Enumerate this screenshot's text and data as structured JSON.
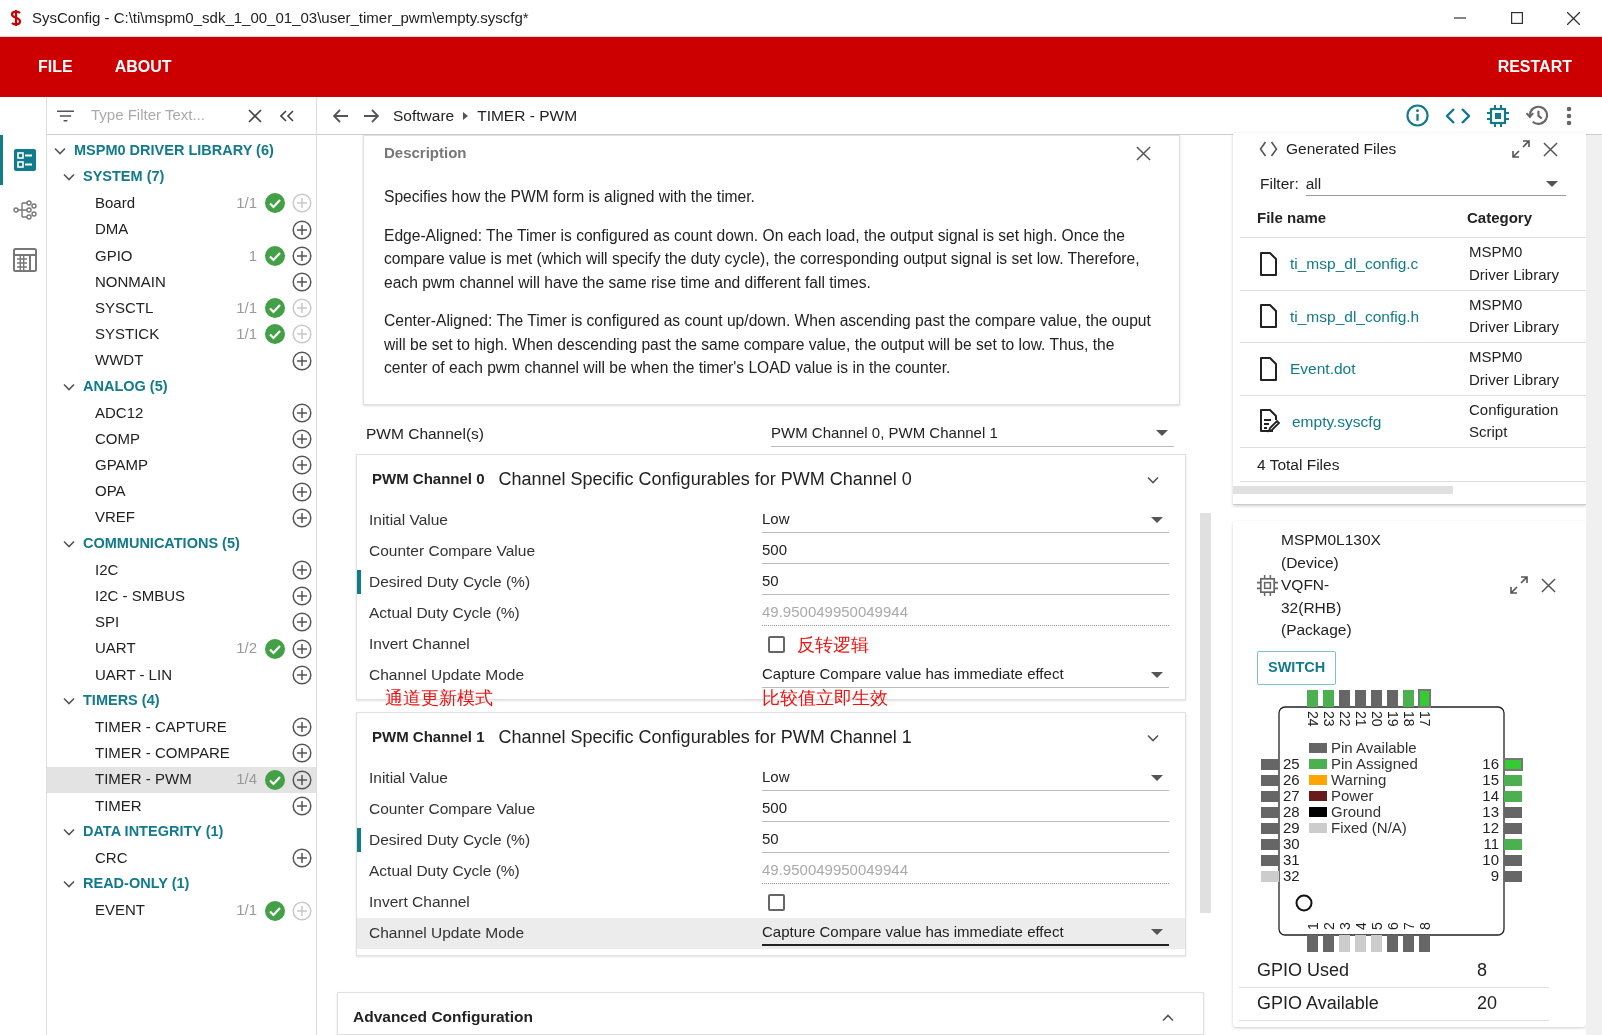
{
  "window": {
    "title": "SysConfig - C:\\ti\\mspm0_sdk_1_00_01_03\\user_timer_pwm\\empty.syscfg*"
  },
  "menu": [
    "FILE",
    "ABOUT"
  ],
  "restart": "RESTART",
  "rail": [
    {
      "kind": "modules",
      "selected": true
    },
    {
      "kind": "graph",
      "selected": false
    },
    {
      "kind": "calculator",
      "selected": false
    }
  ],
  "filter": {
    "placeholder": "Type Filter Text..."
  },
  "tree": {
    "label": "MSPM0 DRIVER LIBRARY (6)",
    "expanded": true,
    "children": [
      {
        "label": "SYSTEM (7)",
        "expanded": true,
        "children": [
          {
            "label": "Board",
            "count": "1/1",
            "configured": true,
            "add_enabled": false,
            "selected": false
          },
          {
            "label": "DMA",
            "configured": false,
            "add_enabled": true,
            "selected": false
          },
          {
            "label": "GPIO",
            "count": "1",
            "configured": true,
            "add_enabled": true,
            "selected": false
          },
          {
            "label": "NONMAIN",
            "configured": false,
            "add_enabled": true,
            "selected": false
          },
          {
            "label": "SYSCTL",
            "count": "1/1",
            "configured": true,
            "add_enabled": false,
            "selected": false
          },
          {
            "label": "SYSTICK",
            "count": "1/1",
            "configured": true,
            "add_enabled": false,
            "selected": false
          },
          {
            "label": "WWDT",
            "configured": false,
            "add_enabled": true,
            "selected": false
          }
        ]
      },
      {
        "label": "ANALOG (5)",
        "expanded": true,
        "children": [
          {
            "label": "ADC12",
            "configured": false,
            "add_enabled": true,
            "selected": false
          },
          {
            "label": "COMP",
            "configured": false,
            "add_enabled": true,
            "selected": false
          },
          {
            "label": "GPAMP",
            "configured": false,
            "add_enabled": true,
            "selected": false
          },
          {
            "label": "OPA",
            "configured": false,
            "add_enabled": true,
            "selected": false
          },
          {
            "label": "VREF",
            "configured": false,
            "add_enabled": true,
            "selected": false
          }
        ]
      },
      {
        "label": "COMMUNICATIONS (5)",
        "expanded": true,
        "children": [
          {
            "label": "I2C",
            "configured": false,
            "add_enabled": true,
            "selected": false
          },
          {
            "label": "I2C - SMBUS",
            "configured": false,
            "add_enabled": true,
            "selected": false
          },
          {
            "label": "SPI",
            "configured": false,
            "add_enabled": true,
            "selected": false
          },
          {
            "label": "UART",
            "count": "1/2",
            "configured": true,
            "add_enabled": true,
            "selected": false
          },
          {
            "label": "UART - LIN",
            "configured": false,
            "add_enabled": true,
            "selected": false
          }
        ]
      },
      {
        "label": "TIMERS (4)",
        "expanded": true,
        "children": [
          {
            "label": "TIMER - CAPTURE",
            "configured": false,
            "add_enabled": true,
            "selected": false
          },
          {
            "label": "TIMER - COMPARE",
            "configured": false,
            "add_enabled": true,
            "selected": false
          },
          {
            "label": "TIMER - PWM",
            "count": "1/4",
            "configured": true,
            "add_enabled": true,
            "selected": true
          },
          {
            "label": "TIMER",
            "configured": false,
            "add_enabled": true,
            "selected": false
          }
        ]
      },
      {
        "label": "DATA INTEGRITY (1)",
        "expanded": true,
        "children": [
          {
            "label": "CRC",
            "configured": false,
            "add_enabled": true,
            "selected": false
          }
        ]
      },
      {
        "label": "READ-ONLY (1)",
        "expanded": true,
        "children": [
          {
            "label": "EVENT",
            "count": "1/1",
            "configured": true,
            "add_enabled": false,
            "selected": false
          }
        ]
      }
    ]
  },
  "breadcrumb": [
    "Software",
    "TIMER - PWM"
  ],
  "description": {
    "title": "Description",
    "paragraphs": [
      "Specifies how the PWM form is aligned with the timer.",
      "Edge-Aligned: The Timer is configured as count down. On each load, the output signal is set high. Once the compare value is met (which will specify the duty cycle), the corresponding output signal is set low. Therefore, each pwm channel will have the same rise time and different fall times.",
      "Center-Aligned: The Timer is configured as count up/down. When ascending past the compare value, the ouput will be set to high. When descending past the same compare value, the output will be set to low. Thus, the center of each pwm channel will be when the timer's LOAD value is in the counter."
    ]
  },
  "pwm_channels": {
    "label": "PWM Channel(s)",
    "value": "PWM Channel 0, PWM Channel 1"
  },
  "channels": [
    {
      "name": "PWM Channel 0",
      "title": "Channel Specific Configurables for PWM Channel 0",
      "expanded": true,
      "rows": [
        {
          "kind": "select",
          "label": "Initial Value",
          "value": "Low",
          "marked": false,
          "hovered": false
        },
        {
          "kind": "text",
          "label": "Counter Compare Value",
          "value": "500",
          "marked": false,
          "hovered": false
        },
        {
          "kind": "text",
          "label": "Desired Duty Cycle (%)",
          "value": "50",
          "marked": true,
          "hovered": false
        },
        {
          "kind": "readonly",
          "label": "Actual Duty Cycle (%)",
          "value": "49.950049950049944",
          "marked": false,
          "hovered": false
        },
        {
          "kind": "checkbox",
          "label": "Invert Channel",
          "checked": false,
          "note": "反转逻辑",
          "marked": false,
          "hovered": false
        },
        {
          "kind": "select",
          "label": "Channel Update Mode",
          "value": "Capture Compare value has immediate effect",
          "label_note": "通道更新模式",
          "value_note": "比较值立即生效",
          "marked": false,
          "hovered": false
        }
      ]
    },
    {
      "name": "PWM Channel 1",
      "title": "Channel Specific Configurables for PWM Channel 1",
      "expanded": true,
      "rows": [
        {
          "kind": "select",
          "label": "Initial Value",
          "value": "Low",
          "marked": false,
          "hovered": false
        },
        {
          "kind": "text",
          "label": "Counter Compare Value",
          "value": "500",
          "marked": false,
          "hovered": false
        },
        {
          "kind": "text",
          "label": "Desired Duty Cycle (%)",
          "value": "50",
          "marked": true,
          "hovered": false
        },
        {
          "kind": "readonly",
          "label": "Actual Duty Cycle (%)",
          "value": "49.950049950049944",
          "marked": false,
          "hovered": false
        },
        {
          "kind": "checkbox",
          "label": "Invert Channel",
          "checked": false,
          "marked": false,
          "hovered": false
        },
        {
          "kind": "select",
          "label": "Channel Update Mode",
          "value": "Capture Compare value has immediate effect",
          "marked": false,
          "hovered": true
        }
      ]
    }
  ],
  "advanced": {
    "title": "Advanced Configuration",
    "expanded": false
  },
  "generated_files": {
    "title": "Generated Files",
    "filter_label": "Filter:",
    "filter_value": "all",
    "columns": [
      "File name",
      "Category"
    ],
    "files": [
      {
        "kind": "file",
        "name": "ti_msp_dl_config.c",
        "category": "MSPM0 Driver Library"
      },
      {
        "kind": "file",
        "name": "ti_msp_dl_config.h",
        "category": "MSPM0 Driver Library"
      },
      {
        "kind": "file",
        "name": "Event.dot",
        "category": "MSPM0 Driver Library"
      },
      {
        "kind": "script",
        "name": "empty.syscfg",
        "category": "Configuration Script"
      }
    ],
    "total": "4 Total Files"
  },
  "device": {
    "info": "MSPM0L130X (Device) VQFN-32(RHB) (Package)",
    "switch": "SWITCH",
    "pins": [
      {
        "number": "24",
        "color": "#4caf50",
        "highlighted": false
      },
      {
        "number": "23",
        "color": "#4caf50",
        "highlighted": false
      },
      {
        "number": "22",
        "color": "#666666",
        "highlighted": false
      },
      {
        "number": "21",
        "color": "#666666",
        "highlighted": false
      },
      {
        "number": "20",
        "color": "#666666",
        "highlighted": false
      },
      {
        "number": "19",
        "color": "#666666",
        "highlighted": false
      },
      {
        "number": "18",
        "color": "#4caf50",
        "highlighted": false
      },
      {
        "number": "17",
        "color": "#33cc33",
        "highlighted": true
      },
      {
        "number": "25",
        "color": "#666666",
        "highlighted": false
      },
      {
        "number": "16",
        "color": "#33cc33",
        "highlighted": true
      },
      {
        "number": "26",
        "color": "#666666",
        "highlighted": false
      },
      {
        "number": "15",
        "color": "#4caf50",
        "highlighted": false
      },
      {
        "number": "27",
        "color": "#666666",
        "highlighted": false
      },
      {
        "number": "14",
        "color": "#4caf50",
        "highlighted": false
      },
      {
        "number": "28",
        "color": "#666666",
        "highlighted": false
      },
      {
        "number": "13",
        "color": "#666666",
        "highlighted": false
      },
      {
        "number": "29",
        "color": "#666666",
        "highlighted": false
      },
      {
        "number": "12",
        "color": "#666666",
        "highlighted": false
      },
      {
        "number": "30",
        "color": "#666666",
        "highlighted": false
      },
      {
        "number": "11",
        "color": "#4caf50",
        "highlighted": false
      },
      {
        "number": "31",
        "color": "#666666",
        "highlighted": false
      },
      {
        "number": "10",
        "color": "#666666",
        "highlighted": false
      },
      {
        "number": "32",
        "color": "#cccccc",
        "highlighted": false
      },
      {
        "number": "9",
        "color": "#666666",
        "highlighted": false
      },
      {
        "number": "1",
        "color": "#666666",
        "highlighted": false
      },
      {
        "number": "2",
        "color": "#666666",
        "highlighted": false
      },
      {
        "number": "3",
        "color": "#cccccc",
        "highlighted": false
      },
      {
        "number": "4",
        "color": "#cccccc",
        "highlighted": false
      },
      {
        "number": "5",
        "color": "#cccccc",
        "highlighted": false
      },
      {
        "number": "6",
        "color": "#666666",
        "highlighted": false
      },
      {
        "number": "7",
        "color": "#666666",
        "highlighted": false
      },
      {
        "number": "8",
        "color": "#666666",
        "highlighted": false
      }
    ],
    "legend": [
      {
        "label": "Pin Available",
        "color": "#666666"
      },
      {
        "label": "Pin Assigned",
        "color": "#4caf50"
      },
      {
        "label": "Warning",
        "color": "#ffa500"
      },
      {
        "label": "Power",
        "color": "#6b1a1a"
      },
      {
        "label": "Ground",
        "color": "#000000"
      },
      {
        "label": "Fixed (N/A)",
        "color": "#cccccc"
      }
    ],
    "stats": [
      {
        "label": "GPIO Used",
        "value": "8"
      },
      {
        "label": "GPIO Available",
        "value": "20"
      }
    ]
  }
}
